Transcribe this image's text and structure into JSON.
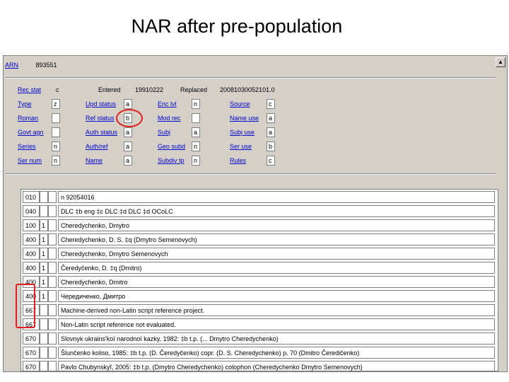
{
  "slide": {
    "title": "NAR after pre-population"
  },
  "header": {
    "arn_label": "ARN",
    "arn_value": "893551"
  },
  "fixed_fields": {
    "row1": {
      "rec_stat": {
        "label": "Rec stat",
        "value": "c"
      },
      "entered": {
        "label": "Entered",
        "value": "19910222"
      },
      "replaced": {
        "label": "Replaced",
        "value": "20081030052101.0"
      }
    },
    "rows": [
      [
        {
          "label": "Type",
          "value": "z"
        },
        {
          "label": "Upd status",
          "value": "a"
        },
        {
          "label": "Enc lvl",
          "value": "n"
        },
        {
          "label": "Source",
          "value": "c"
        }
      ],
      [
        {
          "label": "Roman",
          "value": ""
        },
        {
          "label": "Ref status",
          "value": "b"
        },
        {
          "label": "Mod rec",
          "value": ""
        },
        {
          "label": "Name use",
          "value": "a"
        }
      ],
      [
        {
          "label": "Govt agn",
          "value": ""
        },
        {
          "label": "Auth status",
          "value": "a"
        },
        {
          "label": "Subj",
          "value": "a"
        },
        {
          "label": "Subj use",
          "value": "a"
        }
      ],
      [
        {
          "label": "Series",
          "value": "n"
        },
        {
          "label": "Auth/ref",
          "value": "a"
        },
        {
          "label": "Geo subd",
          "value": "n"
        },
        {
          "label": "Ser use",
          "value": "b"
        }
      ],
      [
        {
          "label": "Ser num",
          "value": "n"
        },
        {
          "label": "Name",
          "value": "a"
        },
        {
          "label": "Subdiv tp",
          "value": "n"
        },
        {
          "label": "Rules",
          "value": "c"
        }
      ]
    ]
  },
  "variable_fields": [
    {
      "tag": "010",
      "ind1": "",
      "ind2": "",
      "text": "n 92054016"
    },
    {
      "tag": "040",
      "ind1": "",
      "ind2": "",
      "text": "DLC ‡b eng ‡c DLC ‡d DLC ‡d OCoLC"
    },
    {
      "tag": "100",
      "ind1": "1",
      "ind2": "",
      "text": "Cheredychenko, Dmytro"
    },
    {
      "tag": "400",
      "ind1": "1",
      "ind2": "",
      "text": "Cheredychenko, D. S. ‡q (Dmytro Semenovych)"
    },
    {
      "tag": "400",
      "ind1": "1",
      "ind2": "",
      "text": "Cheredychenko, Dmytro Semenovych"
    },
    {
      "tag": "400",
      "ind1": "1",
      "ind2": "",
      "text": "Čeredyčenko, D. ‡q (Dmitro)"
    },
    {
      "tag": "400",
      "ind1": "1",
      "ind2": "",
      "text": "Cheredychenko, Dmitro"
    },
    {
      "tag": "400",
      "ind1": "1",
      "ind2": "",
      "text": "Чередиченко, Дмитро"
    },
    {
      "tag": "667",
      "ind1": "",
      "ind2": "",
      "text": "Machine-derived non-Latin script reference project."
    },
    {
      "tag": "667",
      "ind1": "",
      "ind2": "",
      "text": "Non-Latin script reference not evaluated."
    },
    {
      "tag": "670",
      "ind1": "",
      "ind2": "",
      "text": "Slovnyk ukrains'koï narodnoï kazky, 1982: ‡b t.p. (... Dmytro Cheredychenko)"
    },
    {
      "tag": "670",
      "ind1": "",
      "ind2": "",
      "text": "Šlunčenko koliso, 1985: ‡b t.p. (D. Čeredyčenko) copr. (D. S. Cheredychenko) p. 70 (Dmitro Čeredičenko)"
    },
    {
      "tag": "670",
      "ind1": "",
      "ind2": "",
      "text": "Pavlo Chubynskyĭ, 2005: ‡b t.p. (Dmytro Cheredychenko) colophon (Cheredychenko Dmytro Semenovych)"
    }
  ],
  "colors": {
    "link": "#0000cc",
    "highlight": "#e02020",
    "panel": "#d4d0c8"
  }
}
